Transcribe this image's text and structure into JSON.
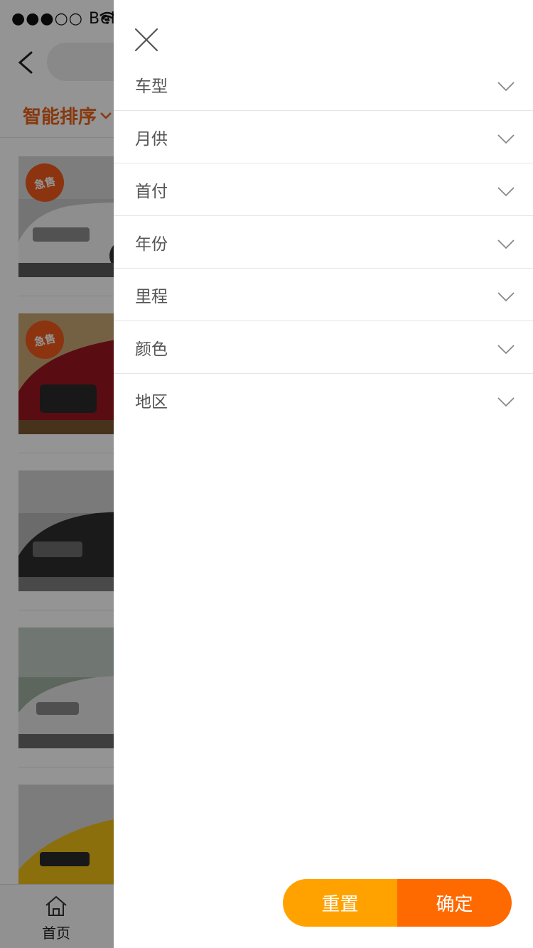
{
  "status_bar": {
    "carrier": "●●●○○ Bell"
  },
  "background": {
    "sort_label": "智能排序",
    "badges": [
      "急售",
      "急售"
    ],
    "tab_home_label": "首页"
  },
  "drawer": {
    "filters": [
      {
        "label": "车型"
      },
      {
        "label": "月供"
      },
      {
        "label": "首付"
      },
      {
        "label": "年份"
      },
      {
        "label": "里程"
      },
      {
        "label": "颜色"
      },
      {
        "label": "地区"
      }
    ],
    "reset_label": "重置",
    "confirm_label": "确定"
  },
  "colors": {
    "accent_text": "#e8621b",
    "reset_button": "#ffa200",
    "confirm_button": "#ff6a00",
    "badge": "#f25a1a"
  },
  "icons": [
    "back-arrow-icon",
    "wifi-icon",
    "chevron-down-icon",
    "close-icon",
    "home-icon"
  ]
}
